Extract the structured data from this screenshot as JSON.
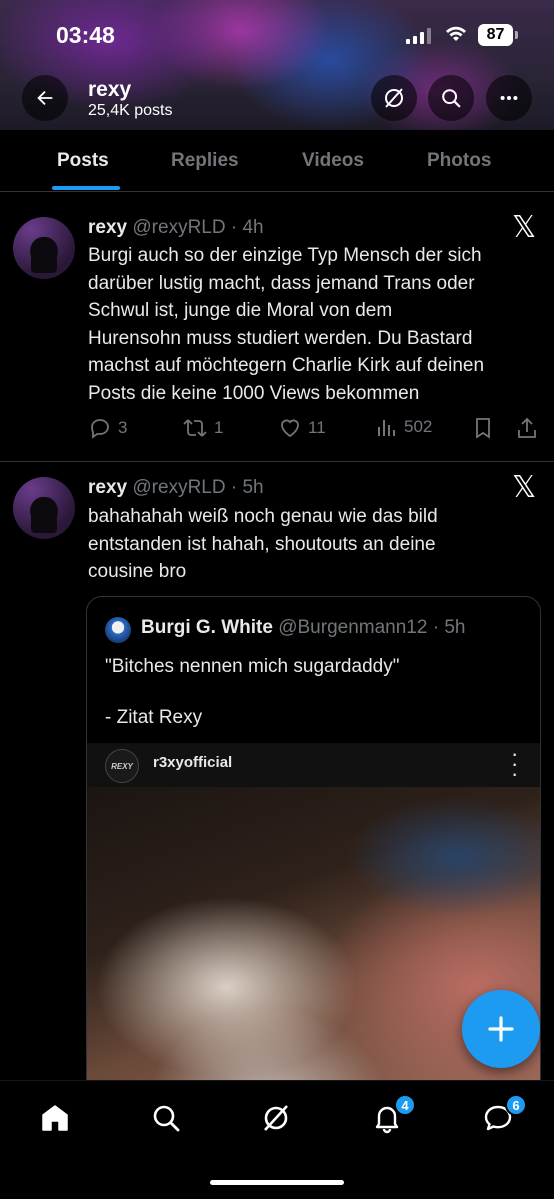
{
  "status_bar": {
    "time": "03:48",
    "battery": "87"
  },
  "profile": {
    "name": "rexy",
    "posts_count": "25,4K posts"
  },
  "tabs": [
    {
      "label": "Posts",
      "active": true
    },
    {
      "label": "Replies",
      "active": false
    },
    {
      "label": "Videos",
      "active": false
    },
    {
      "label": "Photos",
      "active": false
    }
  ],
  "posts": [
    {
      "name": "rexy",
      "handle": "@rexyRLD",
      "time": "· 4h",
      "text": "Burgi auch so der einzige Typ Mensch der sich\ndarüber lustig macht, dass jemand Trans oder\nSchwul ist,  junge die Moral von dem\nHurensohn muss studiert werden. Du Bastard\nmachst auf möchtegern Charlie Kirk auf deinen\nPosts die keine 1000 Views bekommen",
      "replies": "3",
      "reposts": "1",
      "likes": "11",
      "views": "502"
    },
    {
      "name": "rexy",
      "handle": "@rexyRLD",
      "time": "· 5h",
      "text": "bahahahah weiß noch genau wie das bild\nentstanden ist hahah, shoutouts an deine\ncousine bro",
      "quote": {
        "name": "Burgi G. White",
        "handle": "@Burgenmann12",
        "time": "· 5h",
        "text": "\"Bitches nennen mich sugardaddy\"",
        "text2": "- Zitat Rexy",
        "media_account": "r3xyofficial",
        "media_avatar_text": "REXY"
      }
    }
  ],
  "bottom_nav": {
    "notifications_badge": "4",
    "messages_badge": "6"
  },
  "colors": {
    "accent": "#1d9bf0",
    "muted": "#71767b",
    "text": "#e7e9ea",
    "divider": "#2f3336"
  },
  "icons": [
    "back-arrow-icon",
    "grok-icon",
    "search-icon",
    "more-icon",
    "x-logo-icon",
    "reply-icon",
    "repost-icon",
    "like-icon",
    "views-icon",
    "bookmark-icon",
    "share-icon",
    "compose-icon",
    "home-icon",
    "notifications-icon",
    "messages-icon"
  ]
}
